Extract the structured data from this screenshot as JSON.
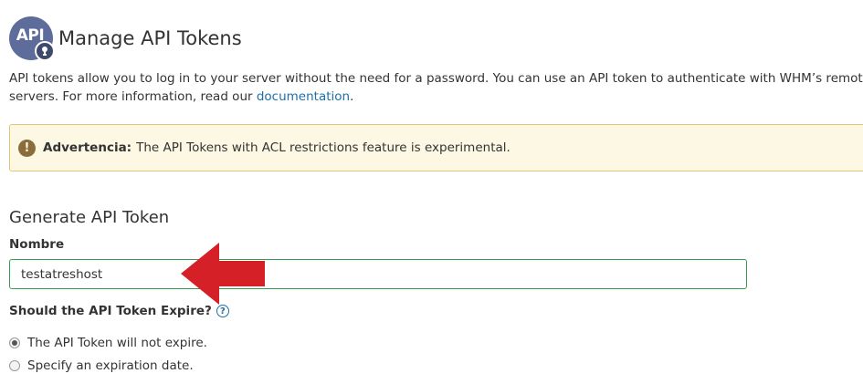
{
  "header": {
    "logo_text": "API",
    "title": "Manage API Tokens"
  },
  "description": {
    "line1": "API tokens allow you to log in to your server without the need for a password. You can use an API token to authenticate with WHM’s remote API.",
    "line2_prefix": "servers. For more information, read our ",
    "line2_link": "documentation",
    "line2_suffix": "."
  },
  "alert": {
    "icon": "exclamation-icon",
    "label": "Advertencia:",
    "message": "The API Tokens with ACL restrictions feature is experimental."
  },
  "generate": {
    "section_title": "Generate API Token",
    "name_label": "Nombre",
    "name_value": "testatreshost",
    "expire_label": "Should the API Token Expire?",
    "options": [
      {
        "label": "The API Token will not expire.",
        "selected": true
      },
      {
        "label": "Specify an expiration date.",
        "selected": false
      }
    ]
  },
  "colors": {
    "logo": "#5d6c9b",
    "link": "#1f6ea6",
    "alert_bg": "#fcf8e3",
    "input_border": "#3a9a53",
    "arrow": "#d42026"
  }
}
